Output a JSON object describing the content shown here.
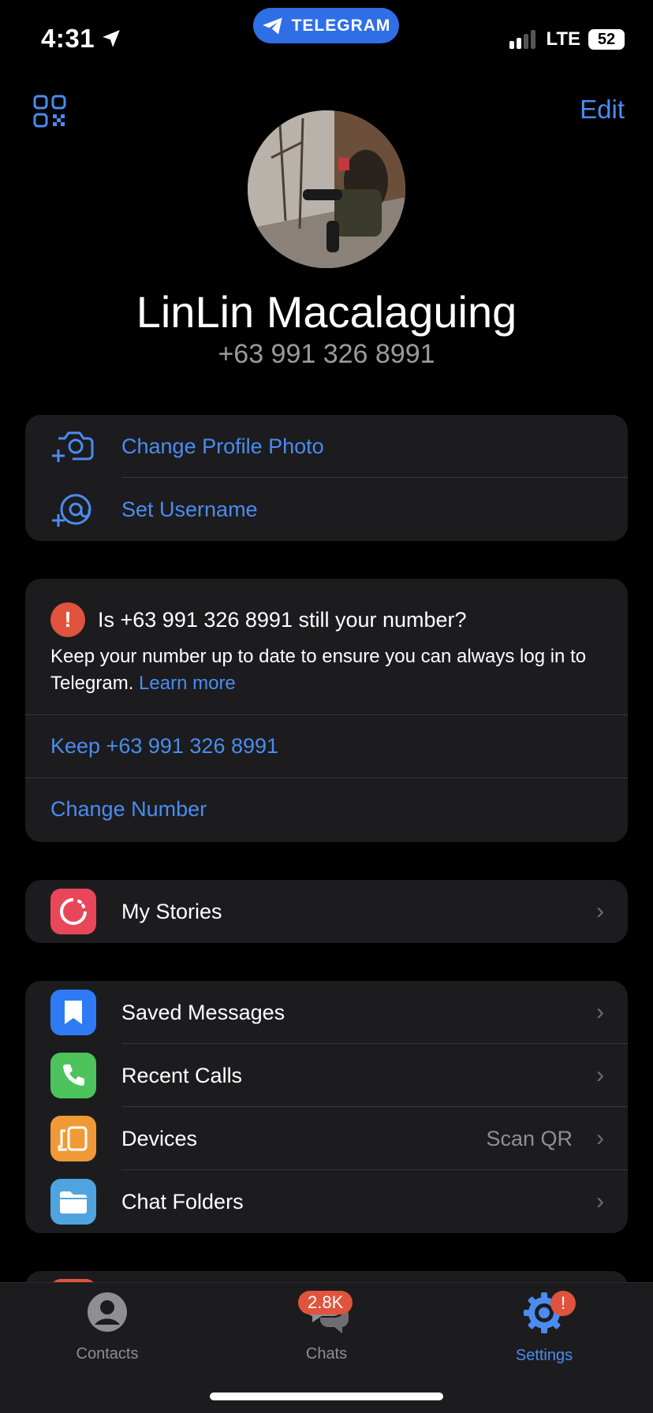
{
  "status_bar": {
    "time": "4:31",
    "app_pill": "TELEGRAM",
    "network": "LTE",
    "battery": "52"
  },
  "header": {
    "edit_label": "Edit",
    "qr_icon": "qr-code-icon"
  },
  "profile": {
    "name": "LinLin Macalaguing",
    "phone": "+63 991 326 8991"
  },
  "profile_actions": [
    {
      "label": "Change Profile Photo",
      "icon": "camera-add-icon"
    },
    {
      "label": "Set Username",
      "icon": "at-add-icon"
    }
  ],
  "number_check": {
    "title": "Is +63 991 326 8991 still your number?",
    "body": "Keep your number up to date to ensure you can always log in to Telegram.",
    "learn_more": "Learn more",
    "keep_label": "Keep +63 991 326 8991",
    "change_label": "Change Number"
  },
  "stories": {
    "label": "My Stories",
    "icon_color": "#e8475a"
  },
  "menu": [
    {
      "label": "Saved Messages",
      "icon": "bookmark-icon",
      "color": "#2f7bf5",
      "value": ""
    },
    {
      "label": "Recent Calls",
      "icon": "phone-icon",
      "color": "#4cc35b",
      "value": ""
    },
    {
      "label": "Devices",
      "icon": "devices-icon",
      "color": "#f09a37",
      "value": "Scan QR"
    },
    {
      "label": "Chat Folders",
      "icon": "folder-icon",
      "color": "#4fa4e0",
      "value": ""
    }
  ],
  "tabbar": {
    "contacts": "Contacts",
    "chats": "Chats",
    "chats_badge": "2.8K",
    "settings": "Settings",
    "settings_badge": "!"
  },
  "colors": {
    "accent": "#4a8cf0",
    "alert": "#e0533d",
    "card": "#1c1c1e"
  }
}
